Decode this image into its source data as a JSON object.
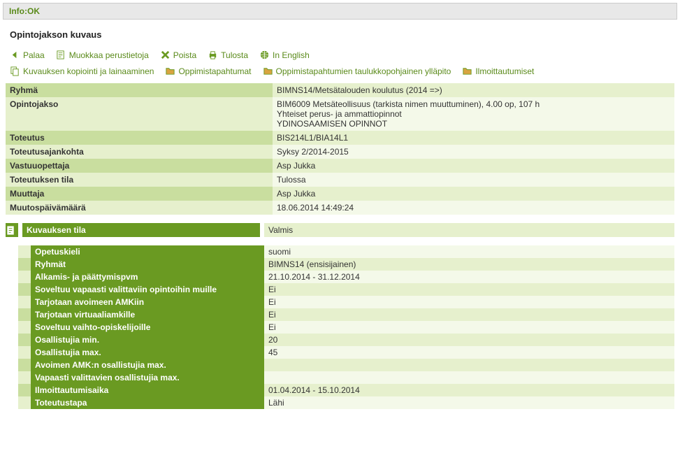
{
  "info_bar": "Info:OK",
  "page_title": "Opintojakson kuvaus",
  "toolbar": {
    "row1": {
      "back": "Palaa",
      "edit": "Muokkaa perustietoja",
      "delete": "Poista",
      "print": "Tulosta",
      "english": "In English"
    },
    "row2": {
      "copy": "Kuvauksen kopiointi ja lainaaminen",
      "events": "Oppimistapahtumat",
      "events_table": "Oppimistapahtumien taulukkopohjainen ylläpito",
      "enroll": "Ilmoittautumiset"
    }
  },
  "summary": {
    "group_label": "Ryhmä",
    "group_value": "BIMNS14/Metsätalouden koulutus (2014 =>)",
    "course_label": "Opintojakso",
    "course_value_line1": "BIM6009 Metsäteollisuus (tarkista nimen muuttuminen), 4.00 op, 107 h",
    "course_value_line2": "Yhteiset perus- ja ammattiopinnot",
    "course_value_line3": "YDINOSAAMISEN OPINNOT",
    "impl_label": "Toteutus",
    "impl_value": "BIS214L1/BIA14L1",
    "period_label": "Toteutusajankohta",
    "period_value": "Syksy 2/2014-2015",
    "teacher_label": "Vastuuopettaja",
    "teacher_value": "Asp Jukka",
    "status_label": "Toteutuksen tila",
    "status_value": "Tulossa",
    "modifier_label": "Muuttaja",
    "modifier_value": "Asp Jukka",
    "modified_label": "Muutospäivämäärä",
    "modified_value": "18.06.2014 14:49:24"
  },
  "desc_status": {
    "label": "Kuvauksen tila",
    "value": "Valmis"
  },
  "details": [
    {
      "label": "Opetuskieli",
      "value": "suomi"
    },
    {
      "label": "Ryhmät",
      "value": "BIMNS14 (ensisijainen)"
    },
    {
      "label": "Alkamis- ja päättymispvm",
      "value": "21.10.2014 - 31.12.2014"
    },
    {
      "label": "Soveltuu vapaasti valittaviin opintoihin muille",
      "value": "Ei"
    },
    {
      "label": "Tarjotaan avoimeen AMKiin",
      "value": "Ei"
    },
    {
      "label": "Tarjotaan virtuaaliamkille",
      "value": "Ei"
    },
    {
      "label": "Soveltuu vaihto-opiskelijoille",
      "value": "Ei"
    },
    {
      "label": "Osallistujia min.",
      "value": "20"
    },
    {
      "label": "Osallistujia max.",
      "value": "45"
    },
    {
      "label": "Avoimen AMK:n osallistujia max.",
      "value": ""
    },
    {
      "label": "Vapaasti valittavien osallistujia max.",
      "value": ""
    },
    {
      "label": "Ilmoittautumisaika",
      "value": "01.04.2014 - 15.10.2014"
    },
    {
      "label": "Toteutustapa",
      "value": "Lähi"
    }
  ]
}
